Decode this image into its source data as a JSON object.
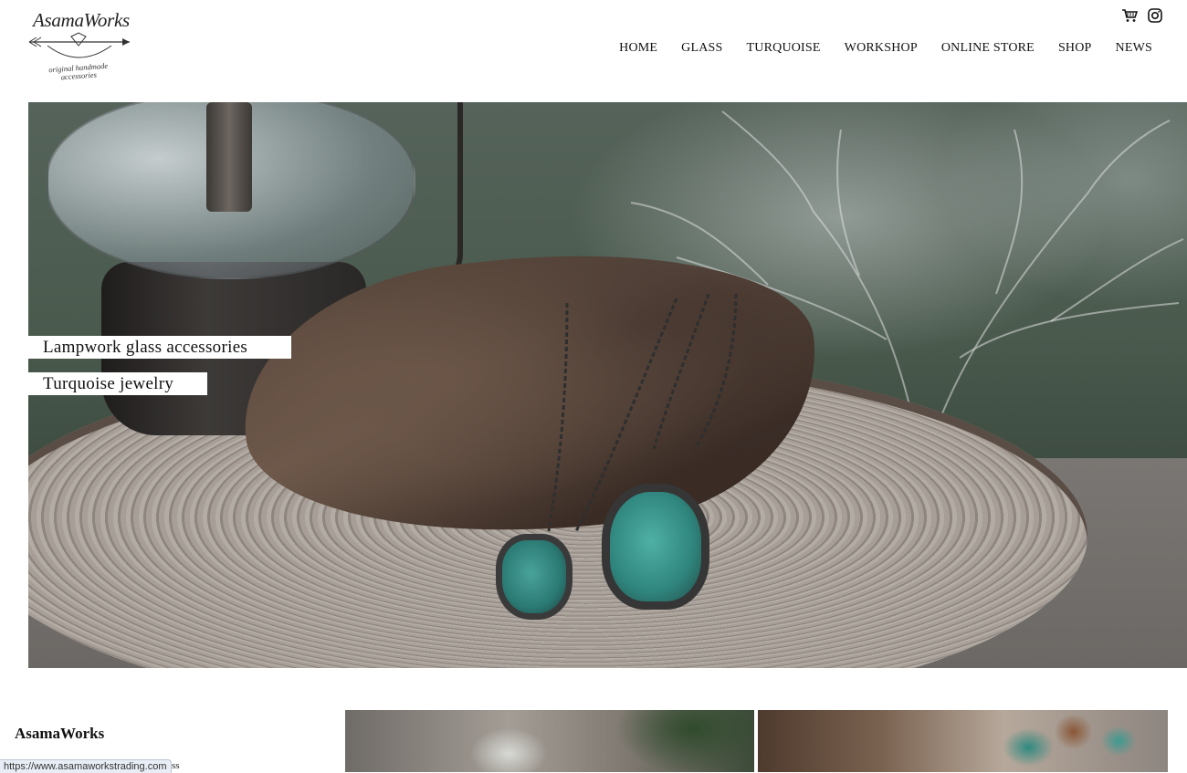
{
  "site": {
    "logo_text": "AsamaWorks",
    "logo_tagline": "original handmade accessories"
  },
  "header_icons": [
    {
      "icon": "shopping-cart-icon"
    },
    {
      "icon": "instagram-icon"
    }
  ],
  "nav": {
    "items": [
      {
        "label": "HOME"
      },
      {
        "label": "GLASS"
      },
      {
        "label": "TURQUOISE"
      },
      {
        "label": "WORKSHOP"
      },
      {
        "label": "ONLINE STORE"
      },
      {
        "label": "SHOP"
      },
      {
        "label": "NEWS"
      }
    ]
  },
  "hero": {
    "captions": [
      {
        "label": "Lampwork glass accessories"
      },
      {
        "label": "Turquoise jewelry"
      }
    ]
  },
  "footer": {
    "brand_title": "AsamaWorks",
    "trailing_text": "ss"
  },
  "status_bar": {
    "url": "https://www.asamaworkstrading.com"
  },
  "colors": {
    "background": "#ffffff",
    "text": "#111111",
    "turquoise": "#2f857d"
  }
}
